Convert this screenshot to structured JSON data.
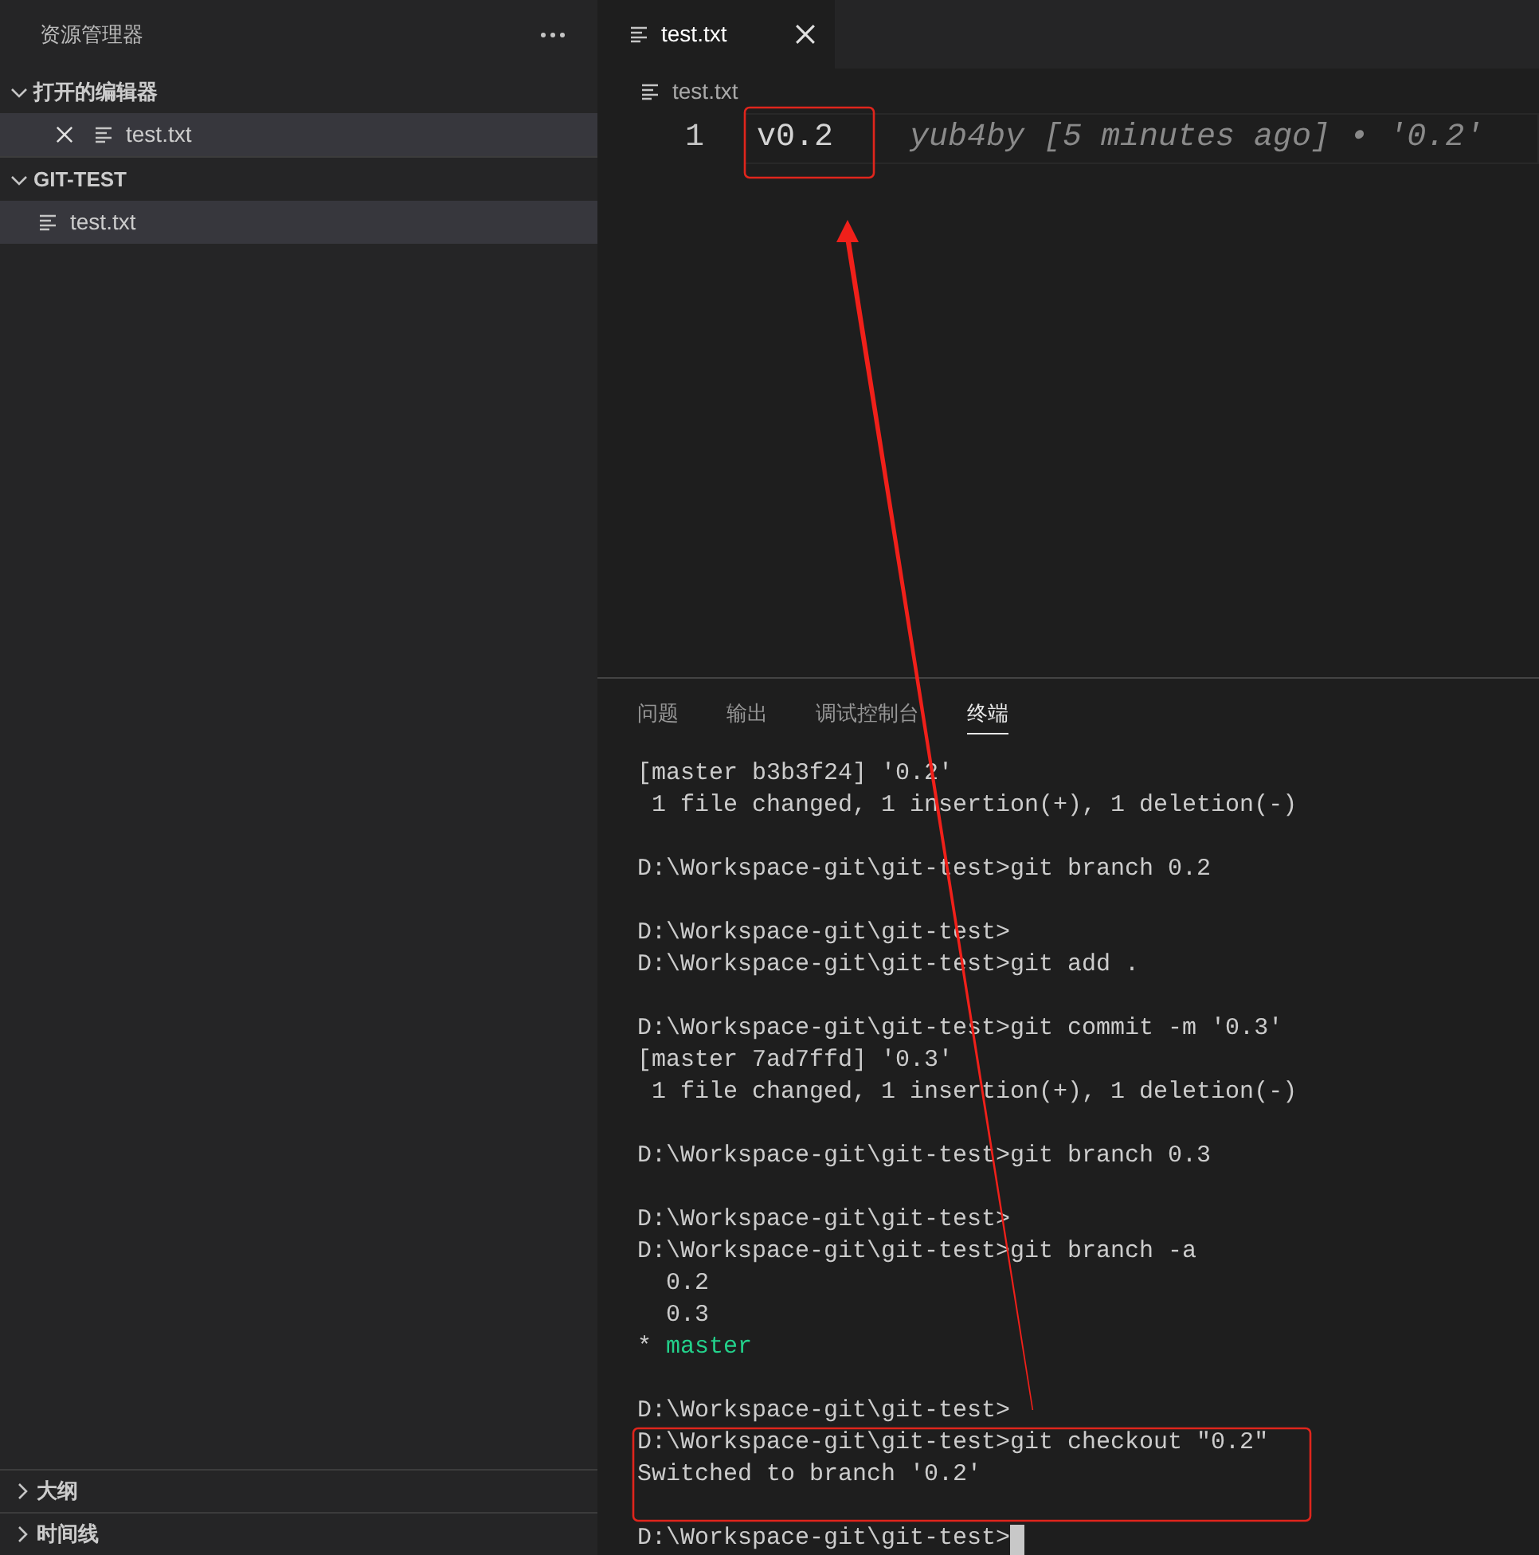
{
  "sidebar": {
    "title": "资源管理器",
    "sections": [
      {
        "title": "打开的编辑器",
        "expanded": true,
        "items": [
          {
            "label": "test.txt",
            "selected": true,
            "closable": true
          }
        ]
      },
      {
        "title": "GIT-TEST",
        "expanded": true,
        "items": [
          {
            "label": "test.txt",
            "selected": true,
            "closable": false
          }
        ]
      }
    ],
    "bottom_sections": [
      {
        "title": "大纲",
        "expanded": false
      },
      {
        "title": "时间线",
        "expanded": false
      }
    ]
  },
  "editor": {
    "tabs": [
      {
        "label": "test.txt",
        "selected": true
      }
    ],
    "breadcrumb": "test.txt",
    "lines": [
      {
        "number": "1",
        "text": "v0.2",
        "blame": "yub4by [5 minutes ago] • '0.2'"
      }
    ]
  },
  "panel": {
    "tabs": [
      {
        "label": "问题",
        "selected": false
      },
      {
        "label": "输出",
        "selected": false
      },
      {
        "label": "调试控制台",
        "selected": false
      },
      {
        "label": "终端",
        "selected": true
      }
    ],
    "terminal": [
      {
        "kind": "text",
        "text": "[master b3b3f24] '0.2'"
      },
      {
        "kind": "text",
        "text": " 1 file changed, 1 insertion(+), 1 deletion(-)"
      },
      {
        "kind": "blank"
      },
      {
        "kind": "text",
        "text": "D:\\Workspace-git\\git-test>git branch 0.2"
      },
      {
        "kind": "blank"
      },
      {
        "kind": "text",
        "text": "D:\\Workspace-git\\git-test>"
      },
      {
        "kind": "text",
        "text": "D:\\Workspace-git\\git-test>git add ."
      },
      {
        "kind": "blank"
      },
      {
        "kind": "text",
        "text": "D:\\Workspace-git\\git-test>git commit -m '0.3'"
      },
      {
        "kind": "text",
        "text": "[master 7ad7ffd] '0.3'"
      },
      {
        "kind": "text",
        "text": " 1 file changed, 1 insertion(+), 1 deletion(-)"
      },
      {
        "kind": "blank"
      },
      {
        "kind": "text",
        "text": "D:\\Workspace-git\\git-test>git branch 0.3"
      },
      {
        "kind": "blank"
      },
      {
        "kind": "text",
        "text": "D:\\Workspace-git\\git-test>"
      },
      {
        "kind": "text",
        "text": "D:\\Workspace-git\\git-test>git branch -a"
      },
      {
        "kind": "text",
        "text": "  0.2"
      },
      {
        "kind": "text",
        "text": "  0.3"
      },
      {
        "kind": "current-branch",
        "marker": "*",
        "text": "master"
      },
      {
        "kind": "blank"
      },
      {
        "kind": "text",
        "text": "D:\\Workspace-git\\git-test>"
      },
      {
        "kind": "text",
        "text": "D:\\Workspace-git\\git-test>git checkout \"0.2\""
      },
      {
        "kind": "text",
        "text": "Switched to branch '0.2'"
      },
      {
        "kind": "blank"
      },
      {
        "kind": "prompt",
        "text": "D:\\Workspace-git\\git-test>"
      }
    ]
  }
}
